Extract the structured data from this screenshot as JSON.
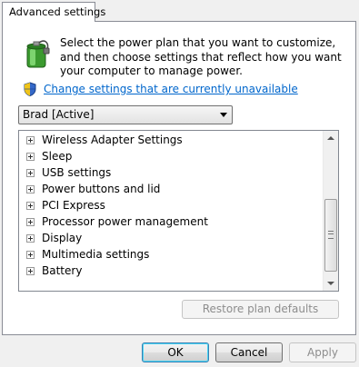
{
  "tab": {
    "label": "Advanced settings"
  },
  "intro": {
    "text": "Select the power plan that you want to customize, and then choose settings that reflect how you want your computer to manage power."
  },
  "link": {
    "label": "Change settings that are currently unavailable"
  },
  "plan_dropdown": {
    "selected": "Brad [Active]"
  },
  "settings_tree": {
    "items": [
      {
        "label": "Wireless Adapter Settings"
      },
      {
        "label": "Sleep"
      },
      {
        "label": "USB settings"
      },
      {
        "label": "Power buttons and lid"
      },
      {
        "label": "PCI Express"
      },
      {
        "label": "Processor power management"
      },
      {
        "label": "Display"
      },
      {
        "label": "Multimedia settings"
      },
      {
        "label": "Battery"
      }
    ]
  },
  "restore_button": {
    "label": "Restore plan defaults",
    "enabled": false
  },
  "buttons": {
    "ok": "OK",
    "cancel": "Cancel",
    "apply": "Apply",
    "apply_enabled": false
  },
  "icons": {
    "plan_icon": "battery-plug-icon",
    "shield_icon": "uac-shield-icon",
    "expander_icon": "plus-expander-icon"
  }
}
